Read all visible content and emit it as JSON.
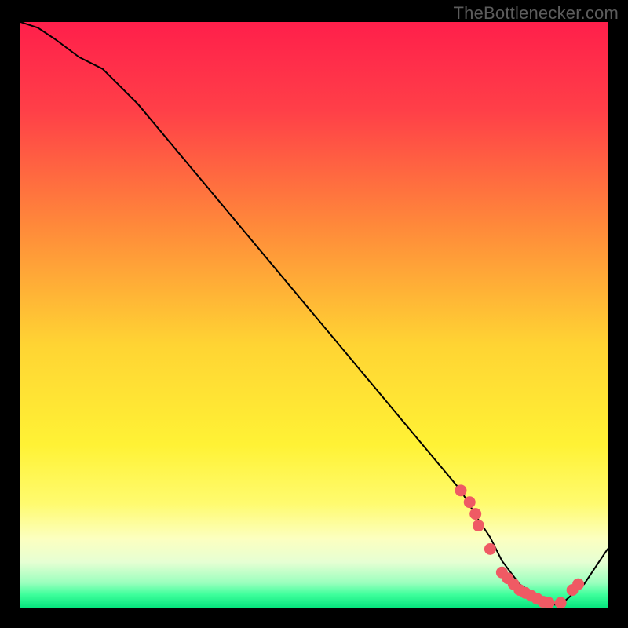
{
  "brand": "TheBottlenecker.com",
  "chart_data": {
    "type": "line",
    "title": "",
    "xlabel": "",
    "ylabel": "",
    "xlim": [
      0,
      100
    ],
    "ylim": [
      0,
      100
    ],
    "series": [
      {
        "name": "bottleneck-curve",
        "x": [
          0,
          3,
          6,
          10,
          14,
          20,
          30,
          40,
          50,
          60,
          70,
          75,
          78,
          80,
          82,
          85,
          88,
          90,
          92,
          96,
          100
        ],
        "y": [
          100,
          99,
          97,
          94,
          92,
          86,
          74,
          62,
          50,
          38,
          26,
          20,
          15,
          12,
          8,
          4,
          2,
          0.5,
          0.5,
          4,
          10
        ]
      }
    ],
    "highlight_points": {
      "name": "bottleneck-markers",
      "color": "#ef5a64",
      "x": [
        75,
        76.5,
        77.5,
        78,
        80,
        82,
        83,
        84,
        85,
        86,
        87,
        88,
        89,
        90,
        92,
        94,
        95
      ],
      "y": [
        20,
        18,
        16,
        14,
        10,
        6,
        5,
        4,
        3,
        2.5,
        2,
        1.5,
        1,
        0.8,
        0.8,
        3,
        4
      ]
    },
    "background": {
      "type": "vertical-gradient",
      "stops": [
        {
          "pos": 0.0,
          "color": "#ff1f4b"
        },
        {
          "pos": 0.15,
          "color": "#ff3f48"
        },
        {
          "pos": 0.35,
          "color": "#ff8a3a"
        },
        {
          "pos": 0.55,
          "color": "#ffd433"
        },
        {
          "pos": 0.72,
          "color": "#fff235"
        },
        {
          "pos": 0.82,
          "color": "#fffb6f"
        },
        {
          "pos": 0.88,
          "color": "#fcffc0"
        },
        {
          "pos": 0.92,
          "color": "#e6ffd3"
        },
        {
          "pos": 0.955,
          "color": "#9bffbe"
        },
        {
          "pos": 0.975,
          "color": "#3fff9c"
        },
        {
          "pos": 1.0,
          "color": "#00e27a"
        }
      ]
    }
  }
}
